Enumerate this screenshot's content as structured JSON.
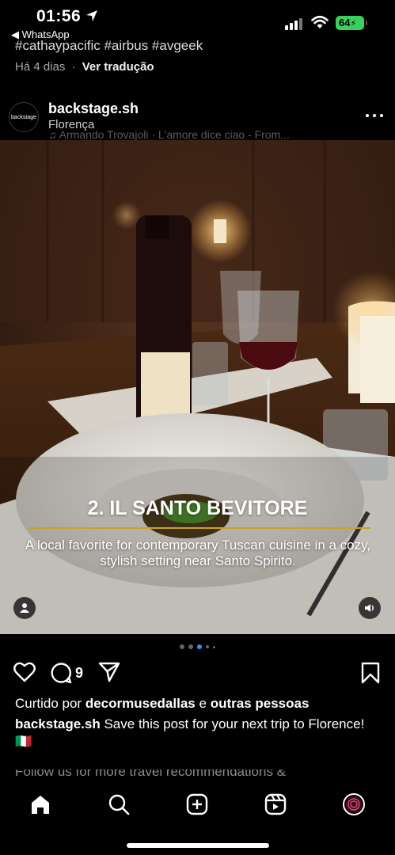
{
  "status_bar": {
    "time": "01:56",
    "back_app": "◀ WhatsApp",
    "battery": "64"
  },
  "previous_post": {
    "hashtags": "#cathaypacific #airbus #avgeek",
    "time_ago": "Há 4 dias",
    "separator": "·",
    "translate": "Ver tradução"
  },
  "post": {
    "avatar_text": "backstage",
    "username": "backstage.sh",
    "location": "Florença",
    "music": "♫ Armando Trovajoli · L'amore dice ciao - From...",
    "overlay_title": "2. IL SANTO BEVITORE",
    "overlay_caption": "A local favorite for contemporary Tuscan cuisine in a cozy, stylish setting near Santo Spirito.",
    "comment_count": "9",
    "liked_prefix": "Curtido por",
    "liked_user": "decormusedallas",
    "liked_and": "e",
    "liked_others": "outras pessoas",
    "caption_user": "backstage.sh",
    "caption_text": "Save this post for your next trip to Florence! 🇮🇹",
    "more_text": "Follow us for more travel recommendations &"
  },
  "carousel": {
    "count": 5,
    "active_index": 2
  },
  "icons": {
    "like": "heart-icon",
    "comment": "comment-icon",
    "share": "paper-plane-icon",
    "save": "bookmark-icon",
    "more": "more-dots-icon",
    "user_tag": "person-icon",
    "sound": "speaker-icon"
  },
  "nav": {
    "items": [
      "home-icon",
      "search-icon",
      "create-icon",
      "reels-icon",
      "profile-icon"
    ]
  },
  "colors": {
    "background": "#000000",
    "accent_line": "#c9a227",
    "active_dot": "#3d8df5",
    "battery": "#39d05c"
  }
}
